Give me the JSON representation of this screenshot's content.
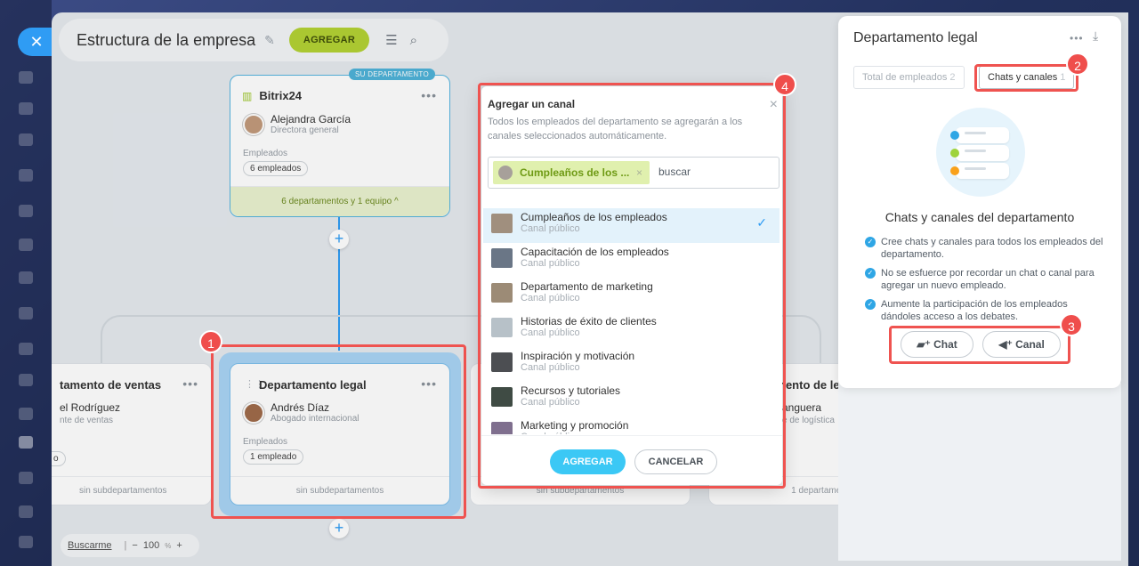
{
  "header": {
    "title": "Estructura de la empresa",
    "add_label": "AGREGAR"
  },
  "nodes": {
    "root": {
      "badge": "SU DEPARTAMENTO",
      "name": "Bitrix24",
      "head_name": "Alejandra García",
      "head_role": "Directora general",
      "employees_label": "Empleados",
      "employees_count": "6 empleados",
      "footer": "6 departamentos y 1 equipo ^"
    },
    "sales": {
      "name": "tamento de ventas",
      "head_name": "el Rodríguez",
      "head_role": "nte de ventas",
      "count": "o",
      "footer": "sin subdepartamentos"
    },
    "legal": {
      "name": "Departamento legal",
      "head_name": "Andrés Díaz",
      "head_role": "Abogado internacional",
      "employees_label": "Empleados",
      "employees_count": "1 empleado",
      "footer": "sin subdepartamentos"
    },
    "middle": {
      "footer": "sin subdepartamentos"
    },
    "logistics": {
      "name": "nento de le",
      "head_name": "anguera",
      "head_role": "e de logística",
      "footer": "1 departamen"
    }
  },
  "zoom": {
    "search_label": "Buscarme",
    "minus": "−",
    "value": "100",
    "unit": "%",
    "plus": "+"
  },
  "modal": {
    "title": "Agregar un canal",
    "description": "Todos los empleados del departamento se agregarán a los canales seleccionados automáticamente.",
    "selected_tag": "Cumpleaños de los ...",
    "search_placeholder": "buscar",
    "items": [
      {
        "name": "Cumpleaños de los empleados",
        "type": "Canal público",
        "thumb": "#a08f7e"
      },
      {
        "name": "Capacitación de los empleados",
        "type": "Canal público",
        "thumb": "#6a7686"
      },
      {
        "name": "Departamento de marketing",
        "type": "Canal público",
        "thumb": "#9c8b76"
      },
      {
        "name": "Historias de éxito de clientes",
        "type": "Canal público",
        "thumb": "#b7c1c8"
      },
      {
        "name": "Inspiración y motivación",
        "type": "Canal público",
        "thumb": "#4c4e52"
      },
      {
        "name": "Recursos y tutoriales",
        "type": "Canal público",
        "thumb": "#3f4b44"
      },
      {
        "name": "Marketing y promoción",
        "type": "Canal público",
        "thumb": "#7f6f8e"
      }
    ],
    "add_label": "AGREGAR",
    "cancel_label": "CANCELAR"
  },
  "right_panel": {
    "title": "Departamento legal",
    "tab_employees": "Total de empleados",
    "tab_employees_count": "2",
    "tab_chats": "Chats y canales",
    "tab_chats_count": "1",
    "heading": "Chats y canales del departamento",
    "bullets": [
      "Cree chats y canales para todos los empleados del departamento.",
      "No se esfuerce por recordar un chat o canal para agregar un nuevo empleado.",
      "Aumente la participación de los empleados dándoles acceso a los debates."
    ],
    "chat_button": "Chat",
    "channel_button": "Canal"
  },
  "markers": [
    "1",
    "2",
    "3",
    "4"
  ],
  "colors": {
    "accent": "#2f9cf4",
    "add_button": "#b4d234",
    "highlight": "#ef5350"
  }
}
